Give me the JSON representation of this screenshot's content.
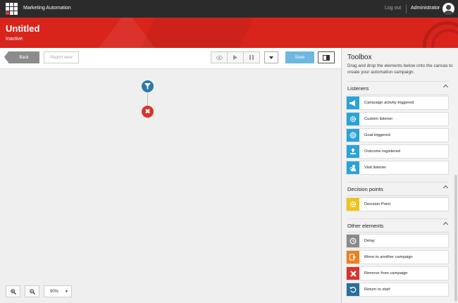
{
  "app": {
    "title": "Marketing Automation",
    "logout": "Log out",
    "user": "Administrator"
  },
  "header": {
    "title": "Untitled",
    "status": "Inactive"
  },
  "toolbar": {
    "back": "Back",
    "report": "Report view",
    "save": "Save"
  },
  "zoom": {
    "value": "90%"
  },
  "toolbox": {
    "title": "Toolbox",
    "description": "Drag and drop the elements below onto the canvas to create your automation campaign.",
    "sections": [
      {
        "name": "Listeners",
        "items": [
          {
            "label": "Campaign activity triggered",
            "icon": "megaphone-icon",
            "color": "#29a3d8"
          },
          {
            "label": "Custom listener",
            "icon": "gear-icon",
            "color": "#29a3d8"
          },
          {
            "label": "Goal triggered",
            "icon": "target-icon",
            "color": "#29a3d8"
          },
          {
            "label": "Outcome registered",
            "icon": "upload-icon",
            "color": "#29a3d8"
          },
          {
            "label": "Visit listener",
            "icon": "visit-icon",
            "color": "#29a3d8"
          }
        ]
      },
      {
        "name": "Decision points",
        "items": [
          {
            "label": "Decision Point",
            "icon": "gear-icon",
            "color": "#f2c318"
          }
        ]
      },
      {
        "name": "Other elements",
        "items": [
          {
            "label": "Delay",
            "icon": "clock-icon",
            "color": "#8a8a8a"
          },
          {
            "label": "Move to another campaign",
            "icon": "move-icon",
            "color": "#f07f1d"
          },
          {
            "label": "Remove from campaign",
            "icon": "close-icon",
            "color": "#d9342b"
          },
          {
            "label": "Return to start",
            "icon": "return-icon",
            "color": "#2a6f9b"
          }
        ]
      }
    ]
  }
}
